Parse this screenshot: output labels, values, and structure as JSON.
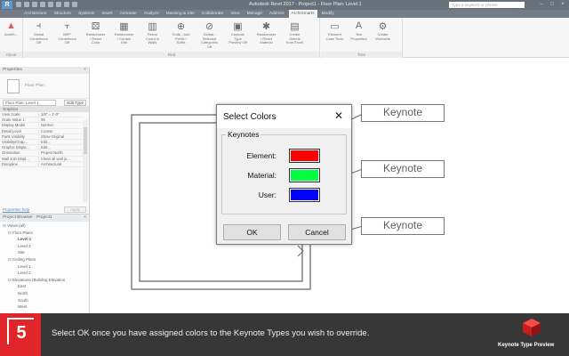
{
  "titlebar": {
    "app_icon": "R",
    "title": "Autodesk Revit 2017 -    Project1 - Floor Plan: Level 1",
    "search_placeholder": "Type a keyword or phrase",
    "window_buttons": [
      "–",
      "□",
      "×"
    ]
  },
  "ribbon": {
    "tabs": [
      "Architecture",
      "Structure",
      "Systems",
      "Insert",
      "Annotate",
      "Analyze",
      "Massing & Site",
      "Collaborate",
      "View",
      "Manage",
      "Add-Ins",
      "Modify"
    ],
    "active_tab": "ArchiSmarts",
    "groups": [
      {
        "label": "About",
        "tools": [
          {
            "label": "ArchiS...",
            "icon": "logo-icon"
          }
        ]
      },
      {
        "label": "Red",
        "tools": [
          {
            "label": "Global Centerlines Off",
            "icon": "centerline-icon"
          },
          {
            "label": "MEP Centerlines Off",
            "icon": "mep-icon"
          },
          {
            "label": "Randomizer / Reset Color",
            "icon": "randomize-icon"
          },
          {
            "label": "Randomizer / Curtain Grid",
            "icon": "grid-icon"
          },
          {
            "label": "Rebar Count in Walls",
            "icon": "rebar-icon"
          },
          {
            "label": "Grids - Add Prefix / Suffix",
            "icon": "grids-icon"
          },
          {
            "label": "Global - Selected Categories Off",
            "icon": "categories-icon"
          },
          {
            "label": "Keynote Type Preview Off",
            "icon": "keynote-icon"
          },
          {
            "label": "Randomizer / Reset Material",
            "icon": "material-icon"
          },
          {
            "label": "Create Sheets from Excel",
            "icon": "sheets-icon"
          }
        ]
      },
      {
        "label": "Tree",
        "tools": [
          {
            "label": "Element Case Tools",
            "icon": "case-icon"
          },
          {
            "label": "Text Properties",
            "icon": "text-icon"
          },
          {
            "label": "Create Worksets",
            "icon": "worksets-icon"
          }
        ]
      }
    ]
  },
  "properties": {
    "header": "Properties",
    "close": "×",
    "type_name": "Floor Plan",
    "instance_select": "Floor Plan: Level 1",
    "edit_type": "Edit Type",
    "section": "Graphics",
    "rows": [
      [
        "View Scale",
        "1/8\" = 1'-0\""
      ],
      [
        "Scale Value  1:",
        "96"
      ],
      [
        "Display Model",
        "Normal"
      ],
      [
        "Detail Level",
        "Coarse"
      ],
      [
        "Parts Visibility",
        "Show Original"
      ],
      [
        "Visibility/Grap...",
        "Edit..."
      ],
      [
        "Graphic Displa...",
        "Edit..."
      ],
      [
        "Orientation",
        "Project North"
      ],
      [
        "Wall Join Displ...",
        "Clean all wall jo..."
      ],
      [
        "Discipline",
        "Architectural"
      ]
    ],
    "help_link": "Properties help",
    "apply": "Apply"
  },
  "browser": {
    "header": "Project Browser - Project1",
    "close": "×",
    "items": [
      {
        "t": "⊟",
        "label": "Views (all)",
        "indent": 0,
        "bold": false
      },
      {
        "t": "⊟",
        "label": "Floor Plans",
        "indent": 1,
        "bold": false
      },
      {
        "t": "",
        "label": "Level 1",
        "indent": 2,
        "bold": true
      },
      {
        "t": "",
        "label": "Level 2",
        "indent": 2,
        "bold": false
      },
      {
        "t": "",
        "label": "Site",
        "indent": 2,
        "bold": false
      },
      {
        "t": "⊟",
        "label": "Ceiling Plans",
        "indent": 1,
        "bold": false
      },
      {
        "t": "",
        "label": "Level 1",
        "indent": 2,
        "bold": false
      },
      {
        "t": "",
        "label": "Level 2",
        "indent": 2,
        "bold": false
      },
      {
        "t": "⊟",
        "label": "Elevations (Building Elevation",
        "indent": 1,
        "bold": false
      },
      {
        "t": "",
        "label": "East",
        "indent": 2,
        "bold": false
      },
      {
        "t": "",
        "label": "North",
        "indent": 2,
        "bold": false
      },
      {
        "t": "",
        "label": "South",
        "indent": 2,
        "bold": false
      },
      {
        "t": "",
        "label": "West",
        "indent": 2,
        "bold": false
      }
    ]
  },
  "canvas": {
    "keynotes": [
      "Keynote",
      "Keynote",
      "Keynote"
    ]
  },
  "dialog": {
    "title": "Select Colors",
    "close": "✕",
    "group_label": "Keynotes",
    "rows": [
      {
        "label": "Element:",
        "color": "#ff0000"
      },
      {
        "label": "Material:",
        "color": "#00ff40"
      },
      {
        "label": "User:",
        "color": "#0000ff"
      }
    ],
    "ok": "OK",
    "cancel": "Cancel"
  },
  "caption": {
    "step": "5",
    "text": "Select OK once you have assigned colors to the Keynote Types you wish to override.",
    "brand": "Keynote Type Preview",
    "accent": "#e0262a"
  }
}
